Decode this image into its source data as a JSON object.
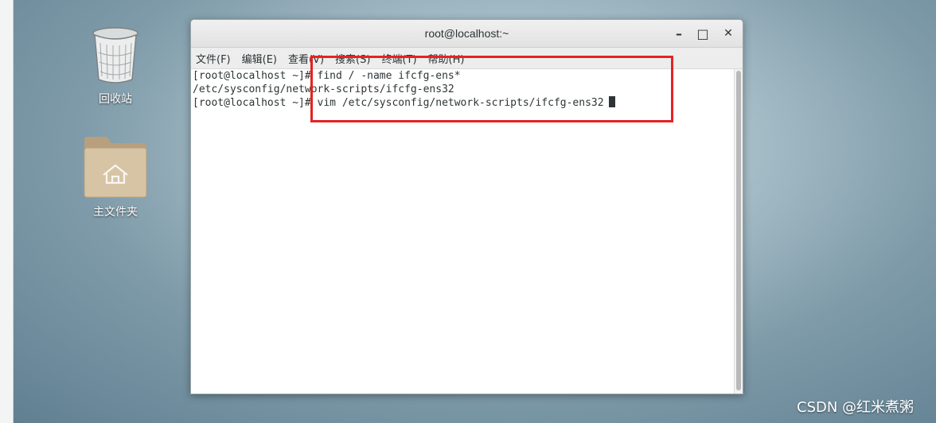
{
  "desktop": {
    "icons": [
      {
        "label": "回收站",
        "icon": "trash-icon"
      },
      {
        "label": "主文件夹",
        "icon": "home-folder-icon"
      }
    ]
  },
  "window": {
    "title": "root@localhost:~",
    "controls": {
      "minimize": "–",
      "maximize": "□",
      "close": "✕"
    },
    "menu": [
      "文件(F)",
      "编辑(E)",
      "查看(V)",
      "搜索(S)",
      "终端(T)",
      "帮助(H)"
    ],
    "lines": [
      "[root@localhost ~]# find / -name ifcfg-ens*",
      "/etc/sysconfig/network-scripts/ifcfg-ens32",
      "[root@localhost ~]# vim /etc/sysconfig/network-scripts/ifcfg-ens32"
    ]
  },
  "annotation": {
    "color": "#e52222"
  },
  "watermark": "CSDN @红米煮粥"
}
